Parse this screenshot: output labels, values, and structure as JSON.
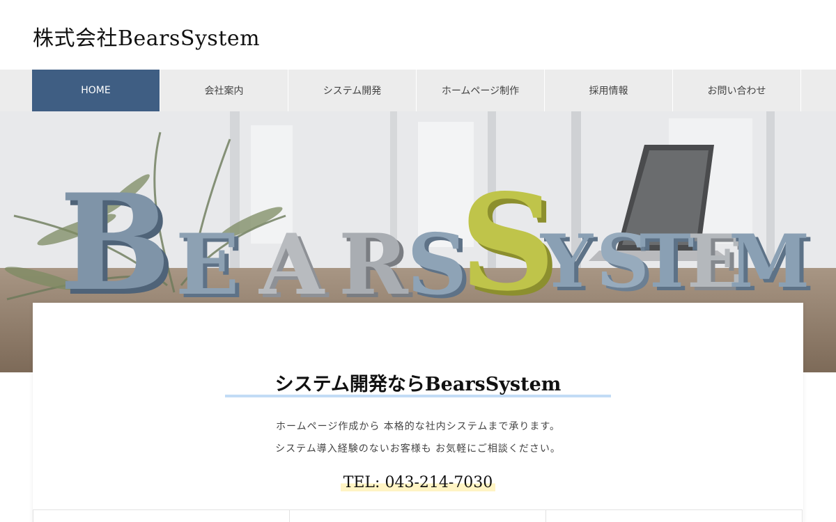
{
  "header": {
    "site_title": "株式会社BearsSystem"
  },
  "nav": {
    "items": [
      {
        "label": "HOME",
        "active": true
      },
      {
        "label": "会社案内",
        "active": false
      },
      {
        "label": "システム開発",
        "active": false
      },
      {
        "label": "ホームページ制作",
        "active": false
      },
      {
        "label": "採用情報",
        "active": false
      },
      {
        "label": "お問い合わせ",
        "active": false
      }
    ]
  },
  "hero": {
    "logo_text": "BEARSSYSTEM"
  },
  "main": {
    "catch_title": "システム開発ならBearsSystem",
    "lead_1": "ホームページ作成から 本格的な社内システムまで承ります。",
    "lead_2": "システム導入経験のないお客様も お気軽にご相談ください。",
    "tel": "TEL: 043-214-7030"
  },
  "colors": {
    "nav_active": "#3f5e83",
    "nav_bg": "#ececec",
    "underline": "#c2dcf5",
    "tel_highlight": "#fff4c4"
  }
}
